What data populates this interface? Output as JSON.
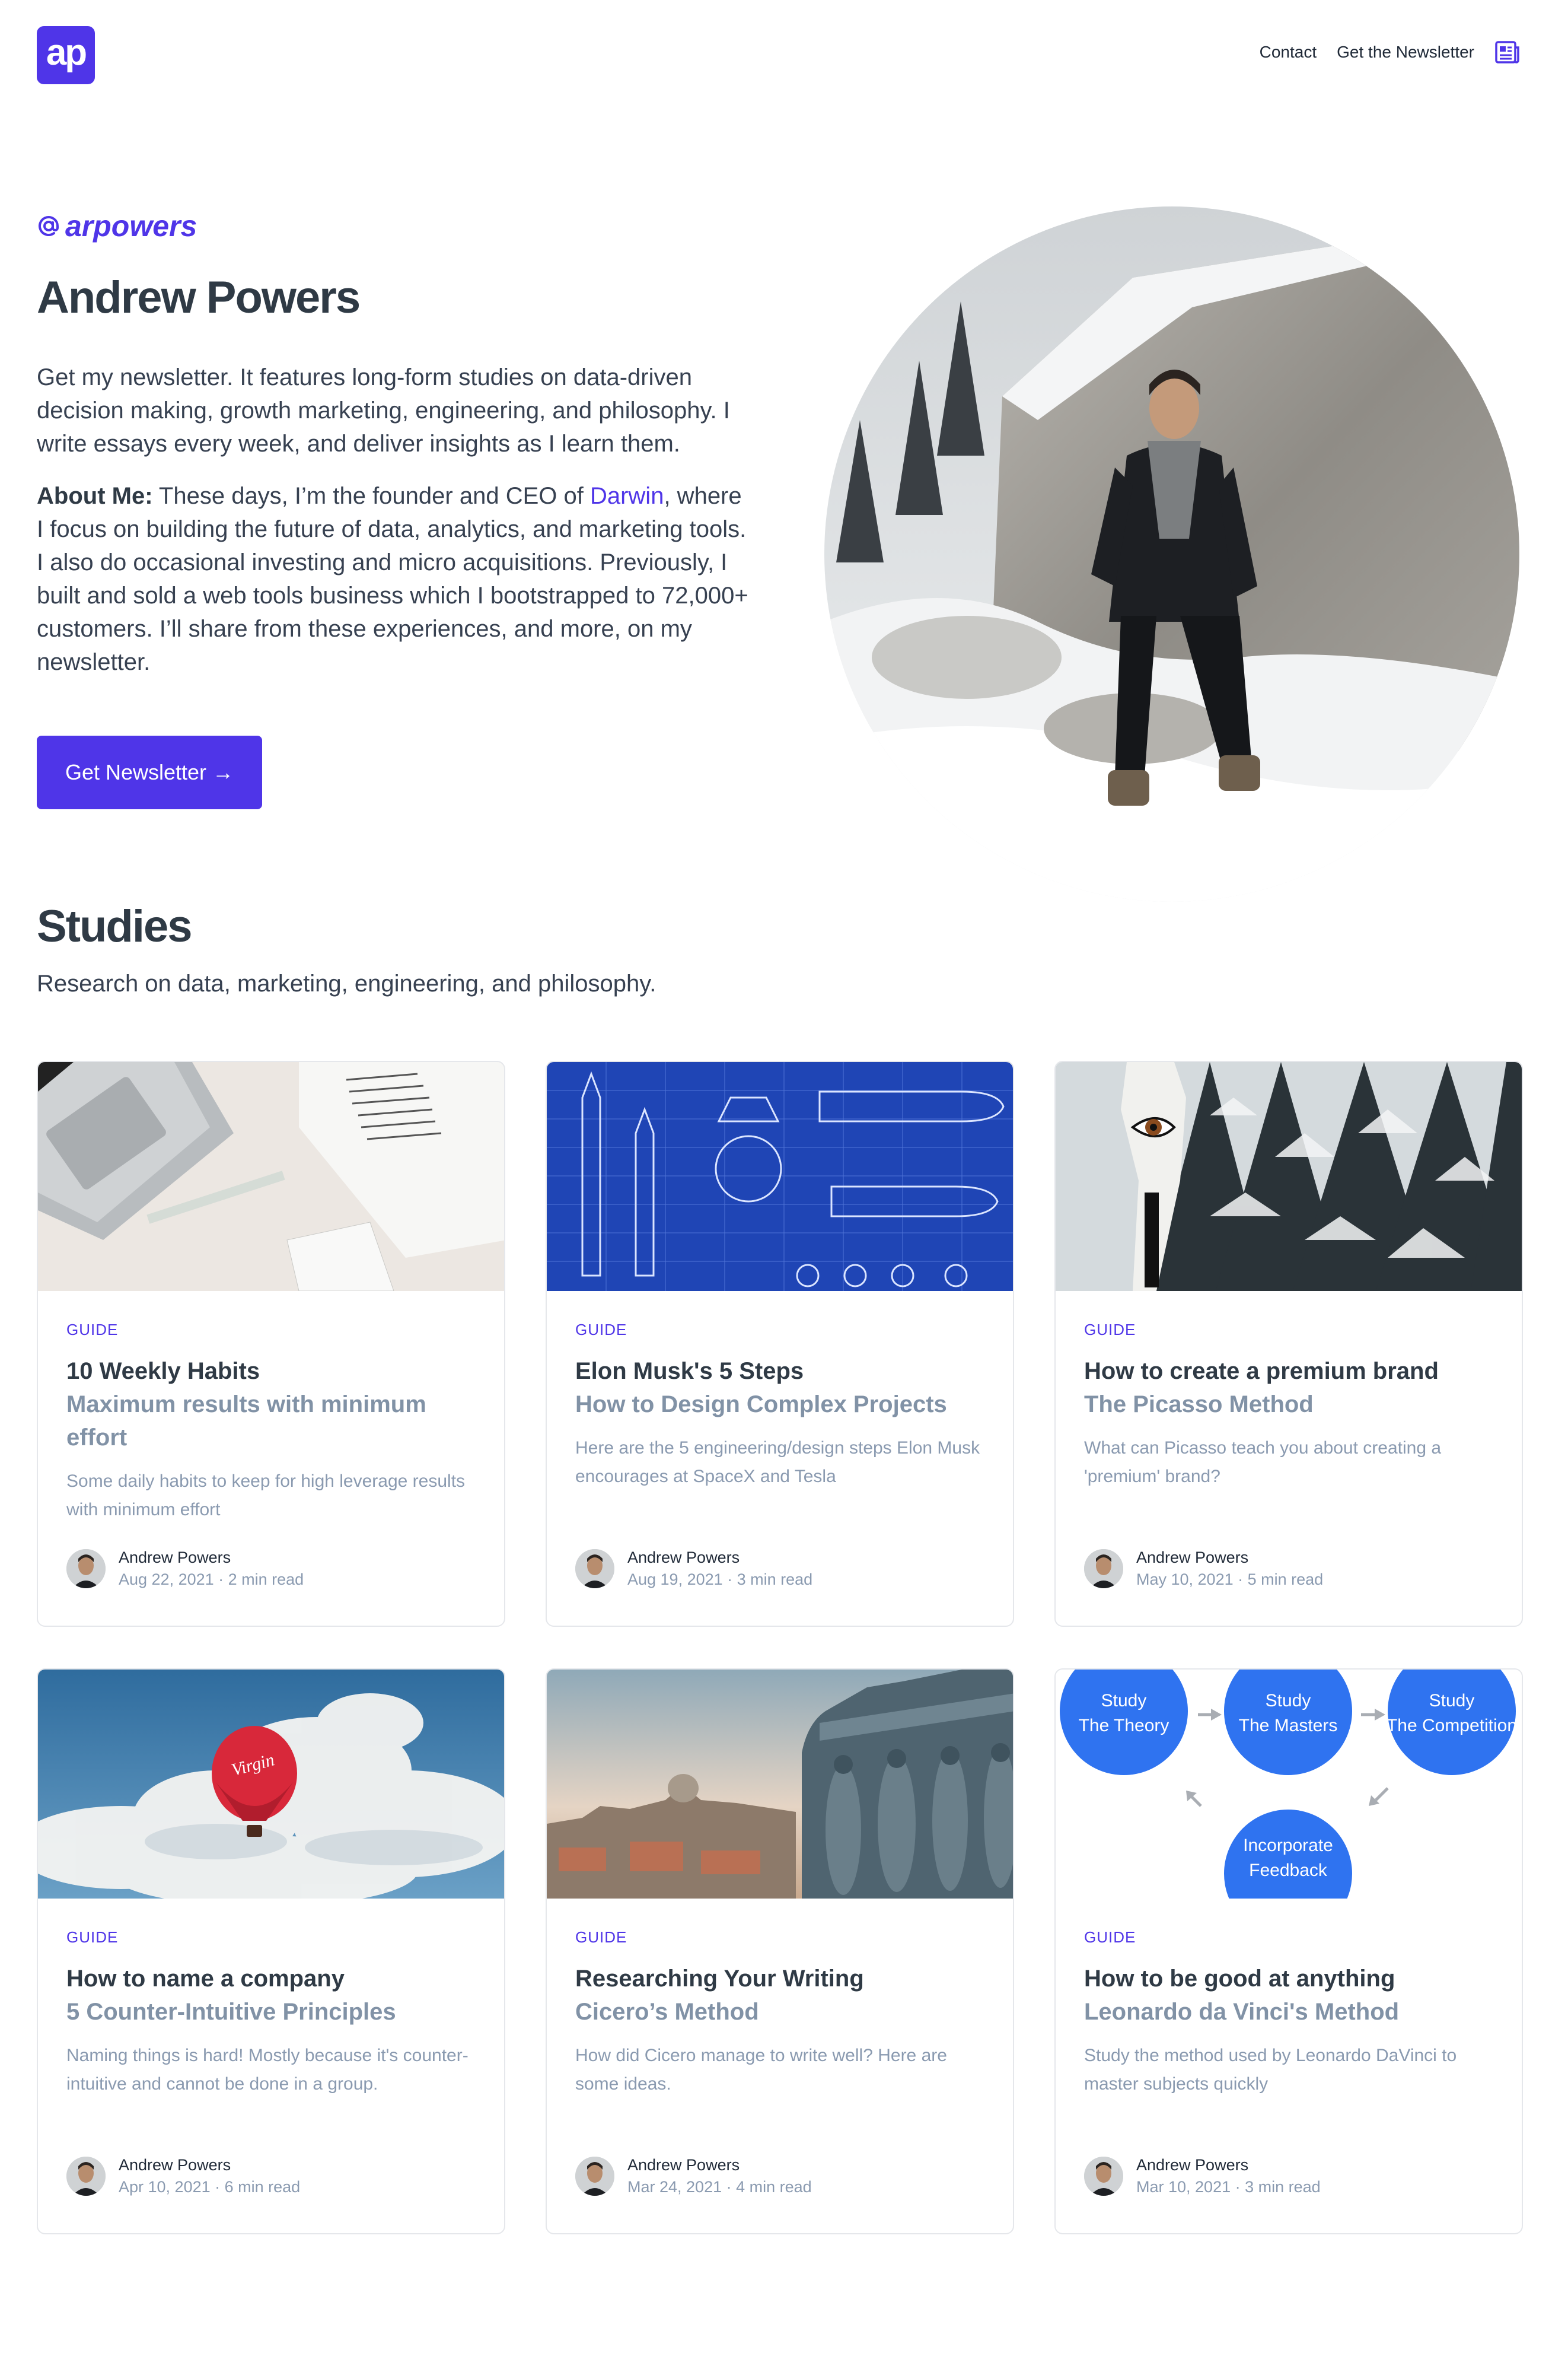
{
  "header": {
    "logo_text": "ap",
    "nav": {
      "contact": "Contact",
      "newsletter": "Get the Newsletter"
    }
  },
  "hero": {
    "handle": "arpowers",
    "name": "Andrew Powers",
    "intro": "Get my newsletter. It features long-form studies on data-driven decision making, growth marketing, engineering, and philosophy. I write essays every week, and deliver insights as I learn them.",
    "about_label": "About Me:",
    "about_before": " These days, I’m the founder and CEO of ",
    "about_link": "Darwin",
    "about_after": ", where I focus on building the future of data, analytics, and marketing tools. I also do occasional investing and micro acquisitions. Previously, I built and sold a web tools business which I bootstrapped to 72,000+ customers. I’ll share from these experiences, and more, on my newsletter.",
    "cta_label": "Get Newsletter",
    "cta_arrow": "→"
  },
  "studies": {
    "title": "Studies",
    "subtitle": "Research on data, marketing, engineering, and philosophy.",
    "cards": [
      {
        "tag": "GUIDE",
        "title": "10 Weekly Habits",
        "subtitle": "Maximum results with minimum effort",
        "desc": "Some daily habits to keep for high leverage results with minimum effort",
        "author": "Andrew Powers",
        "meta": "Aug 22, 2021 · 2 min read"
      },
      {
        "tag": "GUIDE",
        "title": "Elon Musk's 5 Steps",
        "subtitle": "How to Design Complex Projects",
        "desc": "Here are the 5 engineering/design steps Elon Musk encourages at SpaceX and Tesla",
        "author": "Andrew Powers",
        "meta": "Aug 19, 2021 · 3 min read"
      },
      {
        "tag": "GUIDE",
        "title": "How to create a premium brand",
        "subtitle": "The Picasso Method",
        "desc": "What can Picasso teach you about creating a 'premium' brand?",
        "author": "Andrew Powers",
        "meta": "May 10, 2021 · 5 min read"
      },
      {
        "tag": "GUIDE",
        "title": "How to name a company",
        "subtitle": "5 Counter-Intuitive Principles",
        "desc": "Naming things is hard! Mostly because it's counter-intuitive and cannot be done in a group.",
        "author": "Andrew Powers",
        "meta": "Apr 10, 2021 · 6 min read"
      },
      {
        "tag": "GUIDE",
        "title": "Researching Your Writing",
        "subtitle": "Cicero’s Method",
        "desc": "How did Cicero manage to write well? Here are some ideas.",
        "author": "Andrew Powers",
        "meta": "Mar 24, 2021 · 4 min read"
      },
      {
        "tag": "GUIDE",
        "title": "How to be good at anything",
        "subtitle": "Leonardo da Vinci's Method",
        "desc": "Study the method used by Leonardo DaVinci to master subjects quickly",
        "author": "Andrew Powers",
        "meta": "Mar 10, 2021 · 3 min read"
      }
    ],
    "diagram": {
      "node1_line1": "Study",
      "node1_line2": "The Theory",
      "node2_line1": "Study",
      "node2_line2": "The Masters",
      "node3_line1": "Study",
      "node3_line2": "The Competition",
      "node4_line1": "Incorporate",
      "node4_line2": "Feedback"
    },
    "balloon_text": "Virgin"
  },
  "colors": {
    "accent": "#4f35e8",
    "heading": "#2f3a45",
    "muted": "#8a9ab0"
  }
}
